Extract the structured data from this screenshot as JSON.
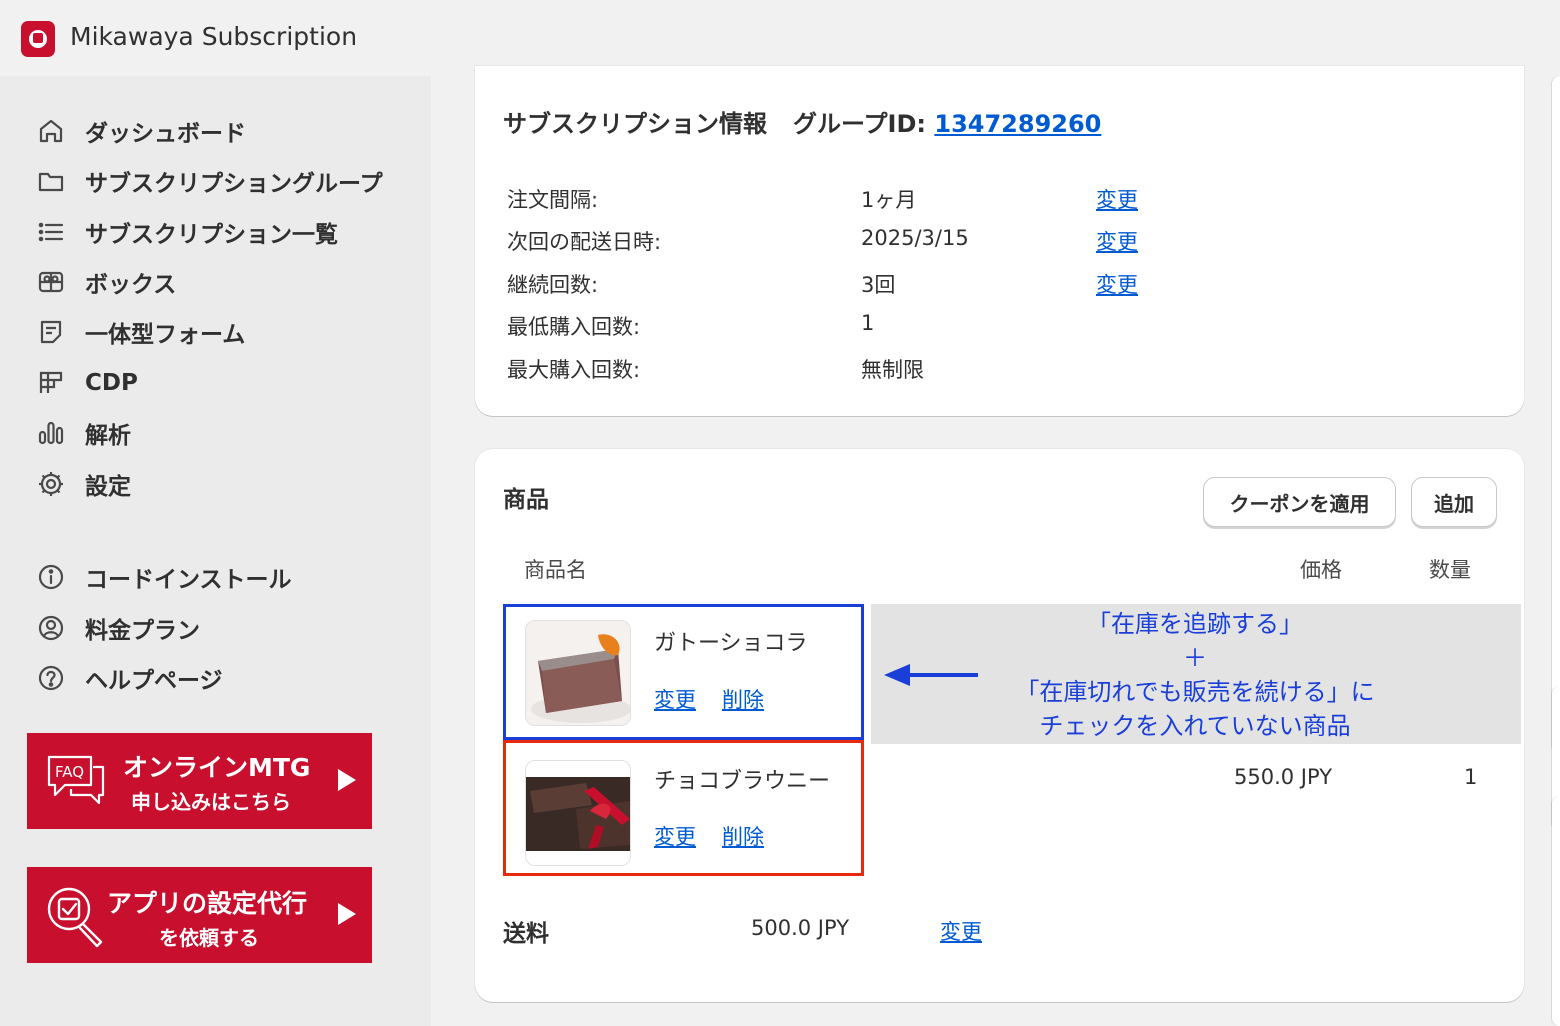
{
  "app": {
    "title": "Mikawaya Subscription"
  },
  "sidebar": {
    "items": [
      {
        "label": "ダッシュボード",
        "icon": "home-icon"
      },
      {
        "label": "サブスクリプショングループ",
        "icon": "folder-icon"
      },
      {
        "label": "サブスクリプション一覧",
        "icon": "list-icon"
      },
      {
        "label": "ボックス",
        "icon": "gift-box-icon"
      },
      {
        "label": "一体型フォーム",
        "icon": "form-icon"
      },
      {
        "label": "CDP",
        "icon": "grid-icon"
      },
      {
        "label": "解析",
        "icon": "bar-chart-icon"
      },
      {
        "label": "設定",
        "icon": "gear-icon"
      }
    ],
    "secondary": [
      {
        "label": "コードインストール",
        "icon": "info-icon"
      },
      {
        "label": "料金プラン",
        "icon": "user-circle-icon"
      },
      {
        "label": "ヘルプページ",
        "icon": "help-icon"
      }
    ],
    "promos": [
      {
        "badge": "FAQ",
        "line1": "オンラインMTG",
        "line2": "申し込みはこちら",
        "icon": "faq-chat-icon"
      },
      {
        "line1": "アプリの設定代行",
        "line2": "を依頼する",
        "icon": "magnifier-check-icon"
      }
    ]
  },
  "subscription": {
    "title": "サブスクリプション情報",
    "group_label": "グループID:",
    "group_id": "1347289260",
    "rows": [
      {
        "label": "注文間隔:",
        "value": "1ヶ月",
        "link": "変更"
      },
      {
        "label": "次回の配送日時:",
        "value": "2025/3/15",
        "link": "変更"
      },
      {
        "label": "継続回数:",
        "value": "3回",
        "link": "変更"
      },
      {
        "label": "最低購入回数:",
        "value": "1"
      },
      {
        "label": "最大購入回数:",
        "value": "無制限"
      }
    ]
  },
  "products": {
    "title": "商品",
    "coupon_button": "クーポンを適用",
    "add_button": "追加",
    "columns": {
      "name": "商品名",
      "price": "価格",
      "quantity": "数量"
    },
    "items": [
      {
        "name": "ガトーショコラ",
        "price": "",
        "quantity": "",
        "change": "変更",
        "delete": "削除"
      },
      {
        "name": "チョコブラウニー",
        "price": "550.0 JPY",
        "quantity": "1",
        "change": "変更",
        "delete": "削除"
      }
    ],
    "shipping_label": "送料",
    "shipping_value": "500.0 JPY",
    "shipping_link": "変更"
  },
  "annotation": {
    "lines": [
      "「在庫を追跡する」",
      "＋",
      "「在庫切れでも販売を続ける」に",
      "チェックを入れていない商品"
    ],
    "colors": {
      "blue": "#1a3fd8",
      "red": "#e8290b"
    }
  },
  "colors": {
    "accent": "#c8102e",
    "link": "#005bd3"
  }
}
